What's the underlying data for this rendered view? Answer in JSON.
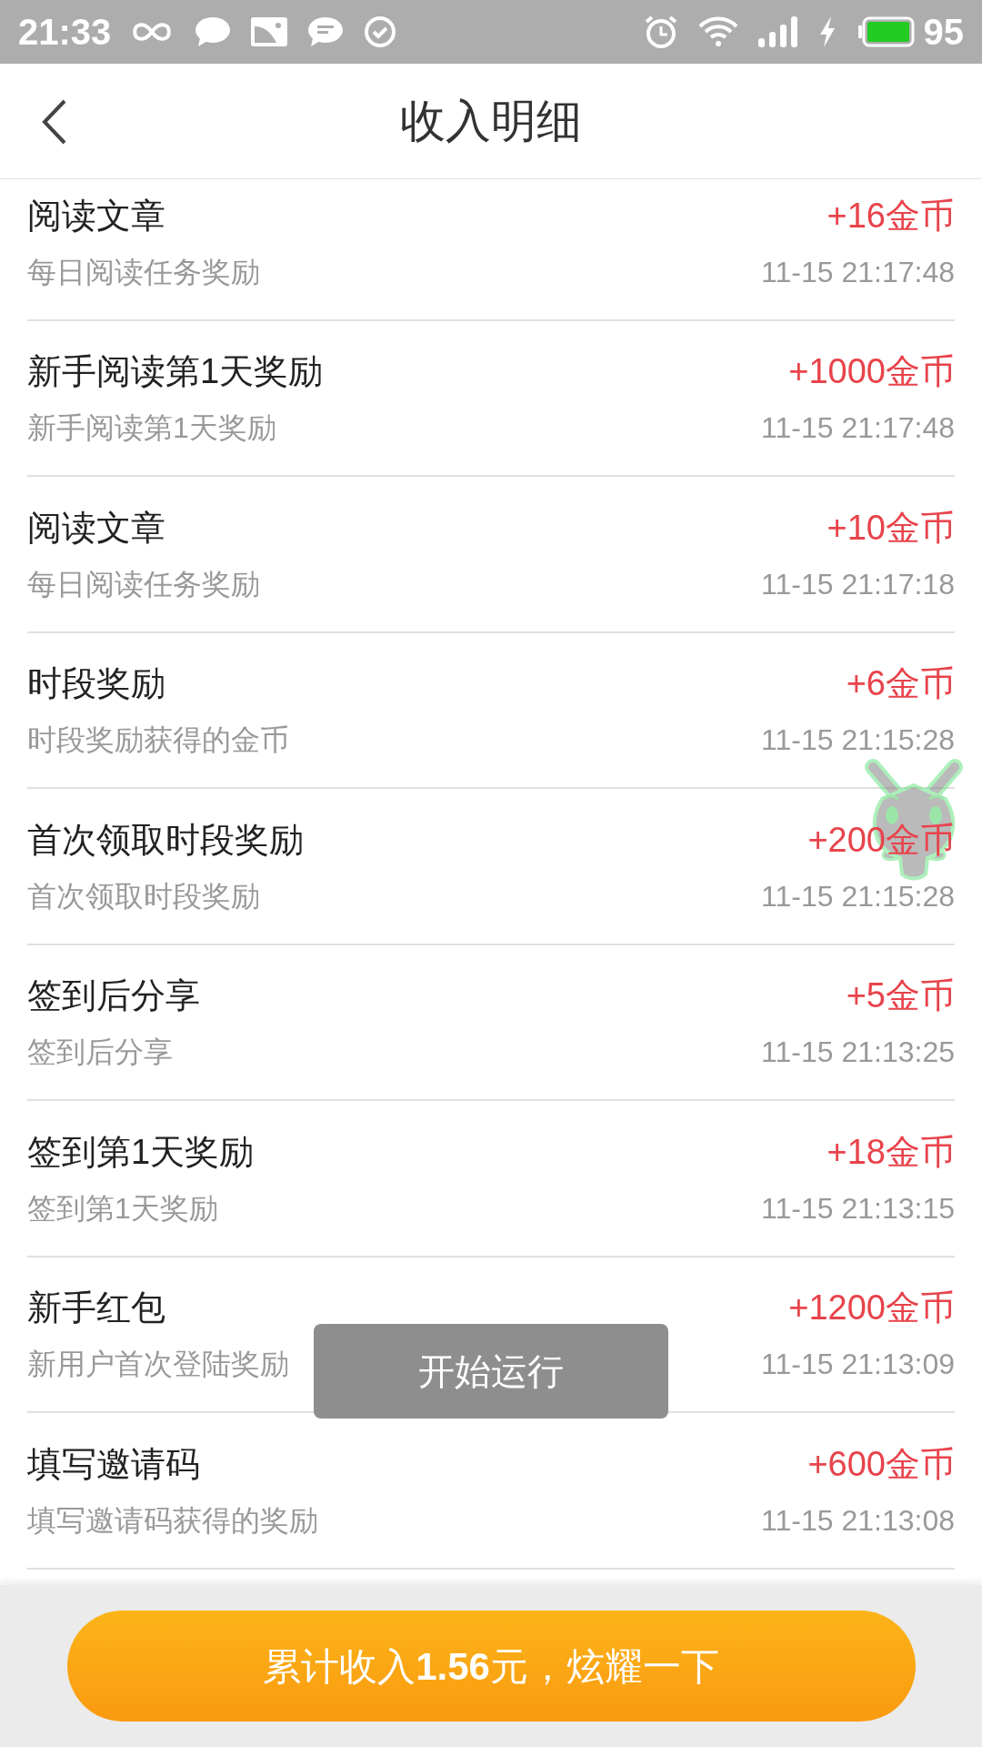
{
  "status_bar": {
    "time": "21:33",
    "battery": "95"
  },
  "header": {
    "title": "收入明细"
  },
  "records": [
    {
      "title": "阅读文章",
      "amount": "+16金币",
      "description": "每日阅读任务奖励",
      "time": "11-15 21:17:48"
    },
    {
      "title": "新手阅读第1天奖励",
      "amount": "+1000金币",
      "description": "新手阅读第1天奖励",
      "time": "11-15 21:17:48"
    },
    {
      "title": "阅读文章",
      "amount": "+10金币",
      "description": "每日阅读任务奖励",
      "time": "11-15 21:17:18"
    },
    {
      "title": "时段奖励",
      "amount": "+6金币",
      "description": "时段奖励获得的金币",
      "time": "11-15 21:15:28"
    },
    {
      "title": "首次领取时段奖励",
      "amount": "+200金币",
      "description": "首次领取时段奖励",
      "time": "11-15 21:15:28"
    },
    {
      "title": "签到后分享",
      "amount": "+5金币",
      "description": "签到后分享",
      "time": "11-15 21:13:25"
    },
    {
      "title": "签到第1天奖励",
      "amount": "+18金币",
      "description": "签到第1天奖励",
      "time": "11-15 21:13:15"
    },
    {
      "title": "新手红包",
      "amount": "+1200金币",
      "description": "新用户首次登陆奖励",
      "time": "11-15 21:13:09"
    },
    {
      "title": "填写邀请码",
      "amount": "+600金币",
      "description": "填写邀请码获得的奖励",
      "time": "11-15 21:13:08"
    }
  ],
  "toast": "开始运行",
  "share_button": "累计收入**1.56**元，炫耀一下"
}
